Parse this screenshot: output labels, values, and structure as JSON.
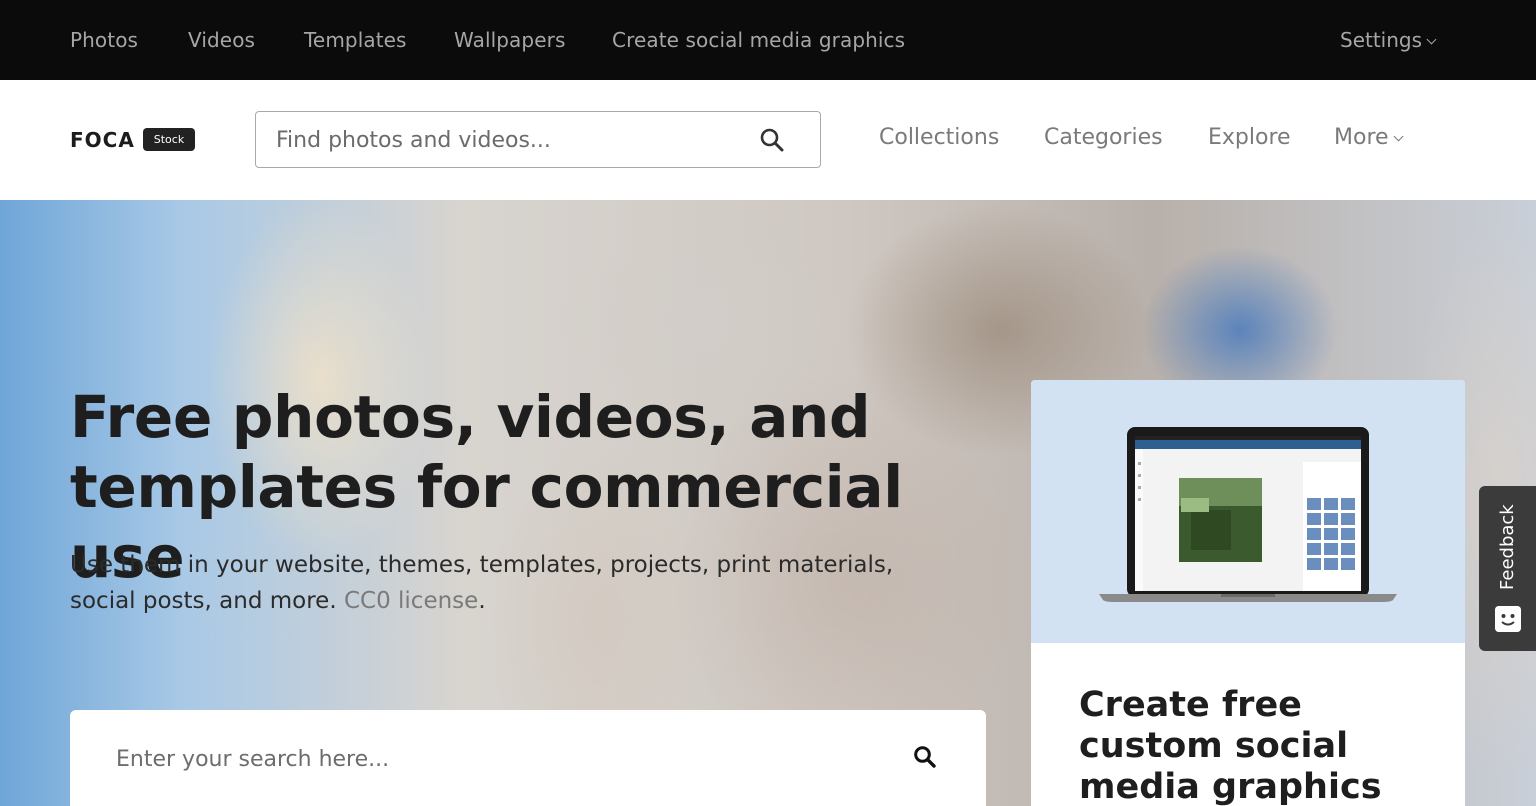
{
  "topbar": {
    "links": [
      "Photos",
      "Videos",
      "Templates",
      "Wallpapers",
      "Create social media graphics"
    ],
    "settings_label": "Settings"
  },
  "header": {
    "logo_text": "FOCA",
    "badge_text": "Stock",
    "search_placeholder": "Find photos and videos...",
    "nav": [
      "Collections",
      "Categories",
      "Explore",
      "More"
    ]
  },
  "hero": {
    "title": "Free photos, videos, and templates for commercial use",
    "subtitle": "Use them in your website, themes, templates, projects, print materials, social posts, and more.",
    "license_link": "CC0 license",
    "license_suffix": ".",
    "search_placeholder": "Enter your search here..."
  },
  "promo": {
    "heading": "Create free custom social media graphics"
  },
  "feedback": {
    "label": "Feedback"
  },
  "colors": {
    "topbar_bg": "#0b0b0b",
    "promo_bg": "#d2e2f2",
    "feedback_bg": "#3b3b3b"
  }
}
